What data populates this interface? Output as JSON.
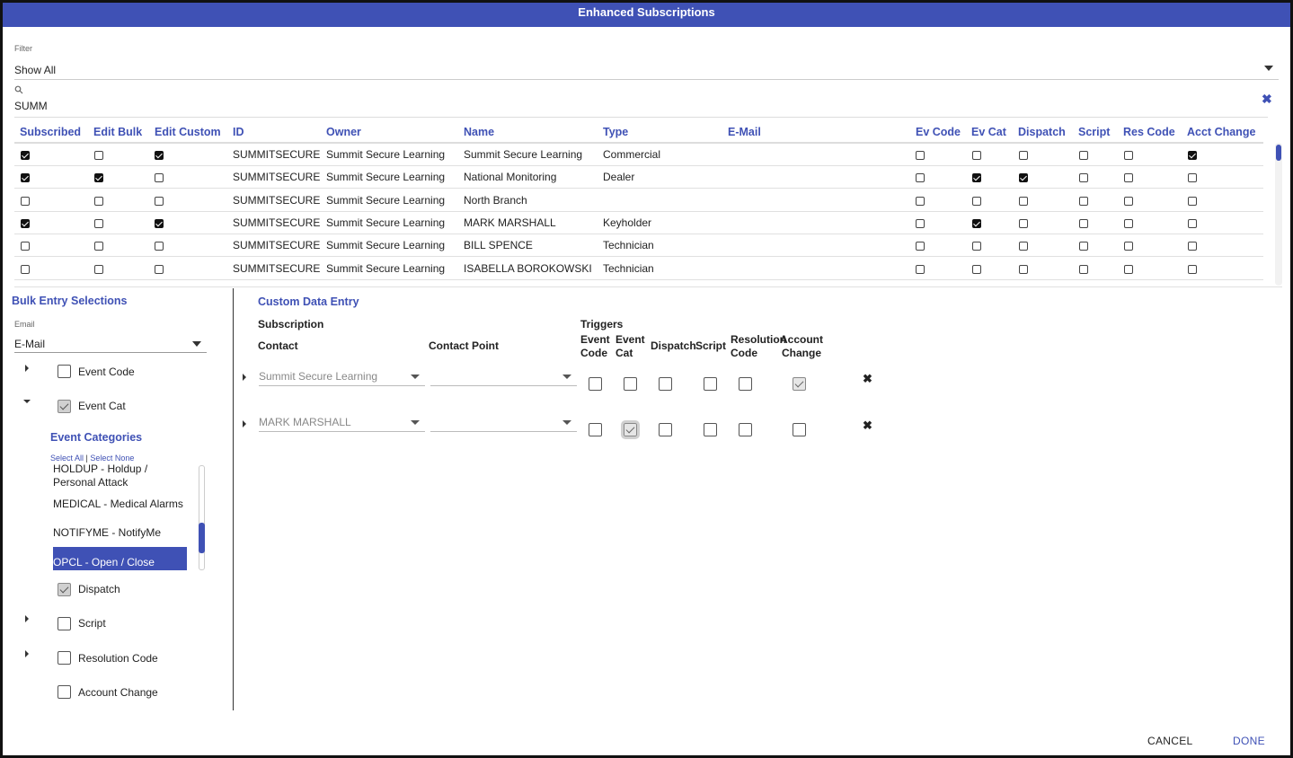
{
  "dialog": {
    "title": "Enhanced Subscriptions"
  },
  "filter": {
    "label": "Filter",
    "value": "Show All"
  },
  "search": {
    "value": "SUMM"
  },
  "grid": {
    "columns": [
      "Subscribed",
      "Edit Bulk",
      "Edit Custom",
      "ID",
      "Owner",
      "Name",
      "Type",
      "E-Mail",
      "Ev Code",
      "Ev Cat",
      "Dispatch",
      "Script",
      "Res Code",
      "Acct Change"
    ],
    "rows": [
      {
        "subscribed": true,
        "edit_bulk": false,
        "edit_custom": true,
        "id": "SUMMITSECURE",
        "owner": "Summit Secure Learning",
        "name": "Summit Secure Learning",
        "type": "Commercial",
        "email": "",
        "ev_code": false,
        "ev_cat": false,
        "dispatch": false,
        "script": false,
        "res_code": false,
        "acct_change": true
      },
      {
        "subscribed": true,
        "edit_bulk": true,
        "edit_custom": false,
        "id": "SUMMITSECURE",
        "owner": "Summit Secure Learning",
        "name": "National Monitoring",
        "type": "Dealer",
        "email": "",
        "ev_code": false,
        "ev_cat": true,
        "dispatch": true,
        "script": false,
        "res_code": false,
        "acct_change": false
      },
      {
        "subscribed": false,
        "edit_bulk": false,
        "edit_custom": false,
        "id": "SUMMITSECURE",
        "owner": "Summit Secure Learning",
        "name": "North Branch",
        "type": "",
        "email": "",
        "ev_code": false,
        "ev_cat": false,
        "dispatch": false,
        "script": false,
        "res_code": false,
        "acct_change": false
      },
      {
        "subscribed": true,
        "edit_bulk": false,
        "edit_custom": true,
        "id": "SUMMITSECURE",
        "owner": "Summit Secure Learning",
        "name": "MARK MARSHALL",
        "type": "Keyholder",
        "email": "",
        "ev_code": false,
        "ev_cat": true,
        "dispatch": false,
        "script": false,
        "res_code": false,
        "acct_change": false
      },
      {
        "subscribed": false,
        "edit_bulk": false,
        "edit_custom": false,
        "id": "SUMMITSECURE",
        "owner": "Summit Secure Learning",
        "name": "BILL SPENCE",
        "type": "Technician",
        "email": "",
        "ev_code": false,
        "ev_cat": false,
        "dispatch": false,
        "script": false,
        "res_code": false,
        "acct_change": false
      },
      {
        "subscribed": false,
        "edit_bulk": false,
        "edit_custom": false,
        "id": "SUMMITSECURE",
        "owner": "Summit Secure Learning",
        "name": "ISABELLA BOROKOWSKI",
        "type": "Technician",
        "email": "",
        "ev_code": false,
        "ev_cat": false,
        "dispatch": false,
        "script": false,
        "res_code": false,
        "acct_change": false
      }
    ]
  },
  "bulk": {
    "title": "Bulk Entry Selections",
    "email_label": "Email",
    "email_value": "E-Mail",
    "event_code": {
      "label": "Event Code",
      "checked": false
    },
    "event_cat": {
      "label": "Event Cat",
      "checked": true
    },
    "categories_title": "Event Categories",
    "select_all": "Select All",
    "separator": "|",
    "select_none": "Select None",
    "categories": [
      {
        "label": "HOLDUP - Holdup / Personal Attack",
        "selected": false
      },
      {
        "label": "MEDICAL - Medical Alarms",
        "selected": false
      },
      {
        "label": "NOTIFYME - NotifyMe",
        "selected": false
      },
      {
        "label": "OPCL - Open / Close",
        "selected": true
      }
    ],
    "dispatch": {
      "label": "Dispatch",
      "checked": true
    },
    "script": {
      "label": "Script",
      "checked": false
    },
    "resolution_code": {
      "label": "Resolution Code",
      "checked": false
    },
    "account_change": {
      "label": "Account Change",
      "checked": false
    }
  },
  "custom": {
    "title": "Custom Data Entry",
    "subscription_header": "Subscription",
    "contact_header": "Contact",
    "contact_point_header": "Contact Point",
    "triggers_header": "Triggers",
    "trigger_cols": [
      {
        "line1": "Event",
        "line2": "Code"
      },
      {
        "line1": "Event",
        "line2": "Cat"
      },
      {
        "line1": "Dispatch",
        "line2": ""
      },
      {
        "line1": "Script",
        "line2": ""
      },
      {
        "line1": "Resolution",
        "line2": "Code"
      },
      {
        "line1": "Account",
        "line2": "Change"
      }
    ],
    "rows": [
      {
        "contact": "Summit Secure Learning",
        "contact_point": "",
        "triggers": [
          false,
          false,
          false,
          false,
          false,
          true
        ]
      },
      {
        "contact": "MARK MARSHALL",
        "contact_point": "",
        "triggers": [
          false,
          true,
          false,
          false,
          false,
          false
        ]
      }
    ]
  },
  "footer": {
    "cancel": "CANCEL",
    "done": "DONE"
  }
}
